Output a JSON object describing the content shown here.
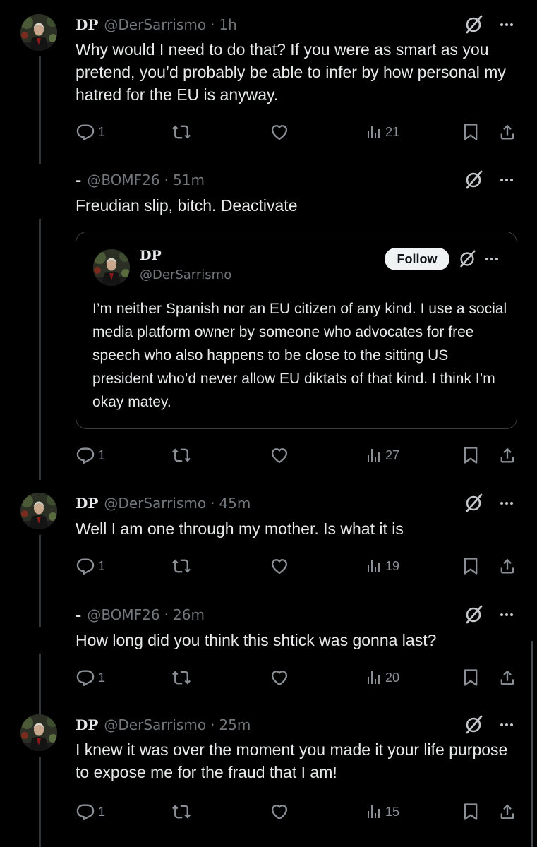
{
  "colors": {
    "background": "#000000",
    "text": "#e7e9ea",
    "muted": "#71767b",
    "icon": "#8b9096",
    "divider": "#333639"
  },
  "tweets": [
    {
      "name": "DP",
      "handle": "@DerSarrismo",
      "separator": "·",
      "time": "1h",
      "text": "Why would I need to do that? If you were as smart as you pretend, you’d probably be able to infer by how personal my hatred for the EU is anyway.",
      "replies": "1",
      "retweets": "",
      "likes": "",
      "views": "21"
    },
    {
      "name": "-",
      "handle": "@BOMF26",
      "separator": "·",
      "time": "51m",
      "text": "Freudian slip, bitch. Deactivate",
      "quote": {
        "name": "DP",
        "handle": "@DerSarrismo",
        "follow_label": "Follow",
        "text": "I’m neither Spanish nor an EU citizen of any kind. I use a social media platform owner by someone who advocates for free speech who also happens to be close to the sitting US president who’d never allow EU diktats of that kind. I think I’m okay matey."
      },
      "replies": "1",
      "retweets": "",
      "likes": "",
      "views": "27"
    },
    {
      "name": "DP",
      "handle": "@DerSarrismo",
      "separator": "·",
      "time": "45m",
      "text": "Well I am one through my mother. Is what it is",
      "replies": "1",
      "retweets": "",
      "likes": "",
      "views": "19"
    },
    {
      "name": "-",
      "handle": "@BOMF26",
      "separator": "·",
      "time": "26m",
      "text": "How long did you think this shtick was gonna last?",
      "replies": "1",
      "retweets": "",
      "likes": "",
      "views": "20"
    },
    {
      "name": "DP",
      "handle": "@DerSarrismo",
      "separator": "·",
      "time": "25m",
      "text": "I knew it was over the moment you made it your life purpose to expose me for the fraud that I am!",
      "replies": "1",
      "retweets": "",
      "likes": "",
      "views": "15"
    }
  ],
  "icons": {
    "reply": "reply-icon",
    "retweet": "retweet-icon",
    "like": "heart-icon",
    "views": "views-icon",
    "bookmark": "bookmark-icon",
    "share": "share-icon",
    "grok": "grok-icon",
    "more": "more-icon"
  }
}
